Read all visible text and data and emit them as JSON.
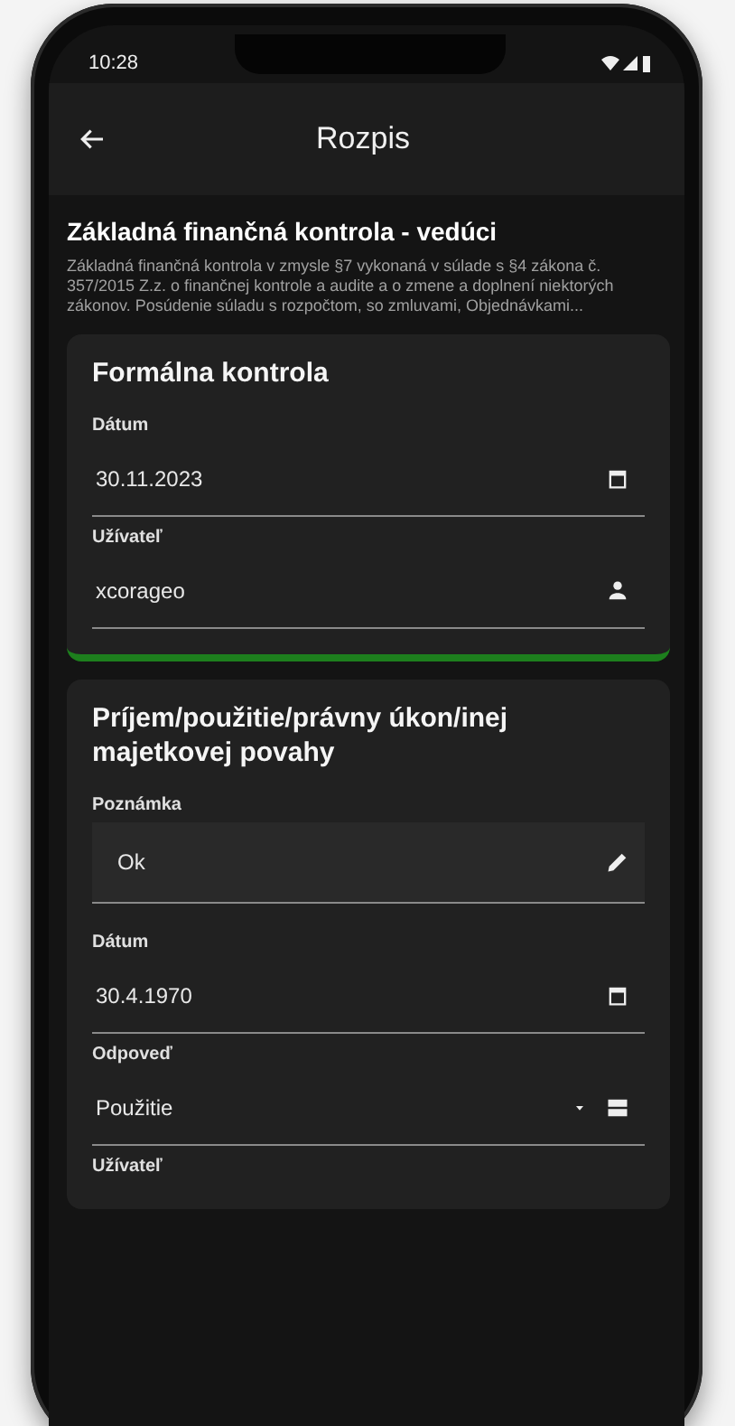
{
  "status_bar": {
    "time": "10:28"
  },
  "app_bar": {
    "title": "Rozpis"
  },
  "header": {
    "title": "Základná finančná kontrola - vedúci",
    "description": "Základná finančná kontrola v zmysle §7 vykonaná v súlade s §4 zákona č. 357/2015 Z.z. o finančnej kontrole a audite a o zmene a doplnení niektorých zákonov. Posúdenie súladu s rozpočtom, so zmluvami, Objednávkami..."
  },
  "cards": [
    {
      "title": "Formálna kontrola",
      "color": "#1d7f1d",
      "fields": [
        {
          "kind": "date",
          "label": "Dátum",
          "value": "30.11.2023"
        },
        {
          "kind": "user",
          "label": "Užívateľ",
          "value": "xcorageo"
        }
      ]
    },
    {
      "title": "Príjem/použitie/právny úkon/inej majetkovej povahy",
      "fields": [
        {
          "kind": "note",
          "label": "Poznámka",
          "value": "Ok"
        },
        {
          "kind": "date",
          "label": "Dátum",
          "value": "30.4.1970"
        },
        {
          "kind": "select",
          "label": "Odpoveď",
          "value": "Použitie"
        },
        {
          "kind": "label",
          "label": "Užívateľ"
        }
      ]
    }
  ]
}
